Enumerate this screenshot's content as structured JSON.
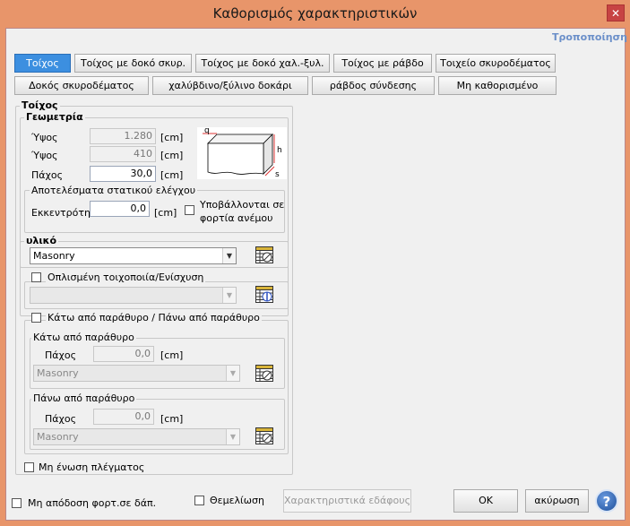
{
  "window": {
    "title": "Καθορισμός χαρακτηριστικών",
    "close": "✕"
  },
  "modify_link": "Τροποποίηση",
  "tabs": [
    {
      "label": "Τοίχος",
      "active": true
    },
    {
      "label": "Τοίχος με δοκό σκυρ."
    },
    {
      "label": "Τοίχος με δοκό χαλ.-ξυλ."
    },
    {
      "label": "Τοίχος με ράβδο"
    },
    {
      "label": "Τοιχείο σκυροδέματος"
    },
    {
      "label": "Δοκός σκυροδέματος"
    },
    {
      "label": "χαλύβδινο/ξύλινο δοκάρι"
    },
    {
      "label": "ράβδος σύνδεσης"
    },
    {
      "label": "Μη καθορισμένο"
    }
  ],
  "wall": {
    "title": "Τοίχος",
    "geometry": {
      "title": "Γεωμετρία",
      "rows": [
        {
          "label": "Ύψος",
          "value": "1.280",
          "unit": "[cm]"
        },
        {
          "label": "Ύψος",
          "value": "410",
          "unit": "[cm]"
        },
        {
          "label": "Πάχος",
          "value": "30,0",
          "unit": "[cm]"
        }
      ],
      "diagram": {
        "q": "q",
        "h": "h",
        "s": "s"
      }
    },
    "static": {
      "title": "Αποτελέσματα στατικού ελέγχου",
      "ecc_label": "Εκκεντρότητε",
      "ecc_value": "0,0",
      "ecc_unit": "[cm]",
      "wind_label1": "Υποβάλλονται σε",
      "wind_label2": "φορτία ανέμου"
    },
    "material": {
      "title": "υλικό",
      "value": "Masonry"
    },
    "reinforced": {
      "label": "Οπλισμένη τοιχοποιία/Ενίσχυση",
      "value": ""
    },
    "window_section": {
      "label": "Κάτω από παράθυρο / Πάνω από παράθυρο",
      "below": {
        "title": "Κάτω από παράθυρο",
        "thick_label": "Πάχος",
        "value": "0,0",
        "unit": "[cm]",
        "material": "Masonry"
      },
      "above": {
        "title": "Πάνω από παράθυρο",
        "thick_label": "Πάχος",
        "value": "0,0",
        "unit": "[cm]",
        "material": "Masonry"
      }
    },
    "no_mesh": "Μη ένωση πλέγματος"
  },
  "footer": {
    "no_load": "Μη απόδοση φορτ.σε δάπ.",
    "foundation": "Θεμελίωση",
    "soil": "Χαρακτηριστικά εδάφους",
    "ok": "OK",
    "cancel": "ακύρωση",
    "help": "?"
  }
}
